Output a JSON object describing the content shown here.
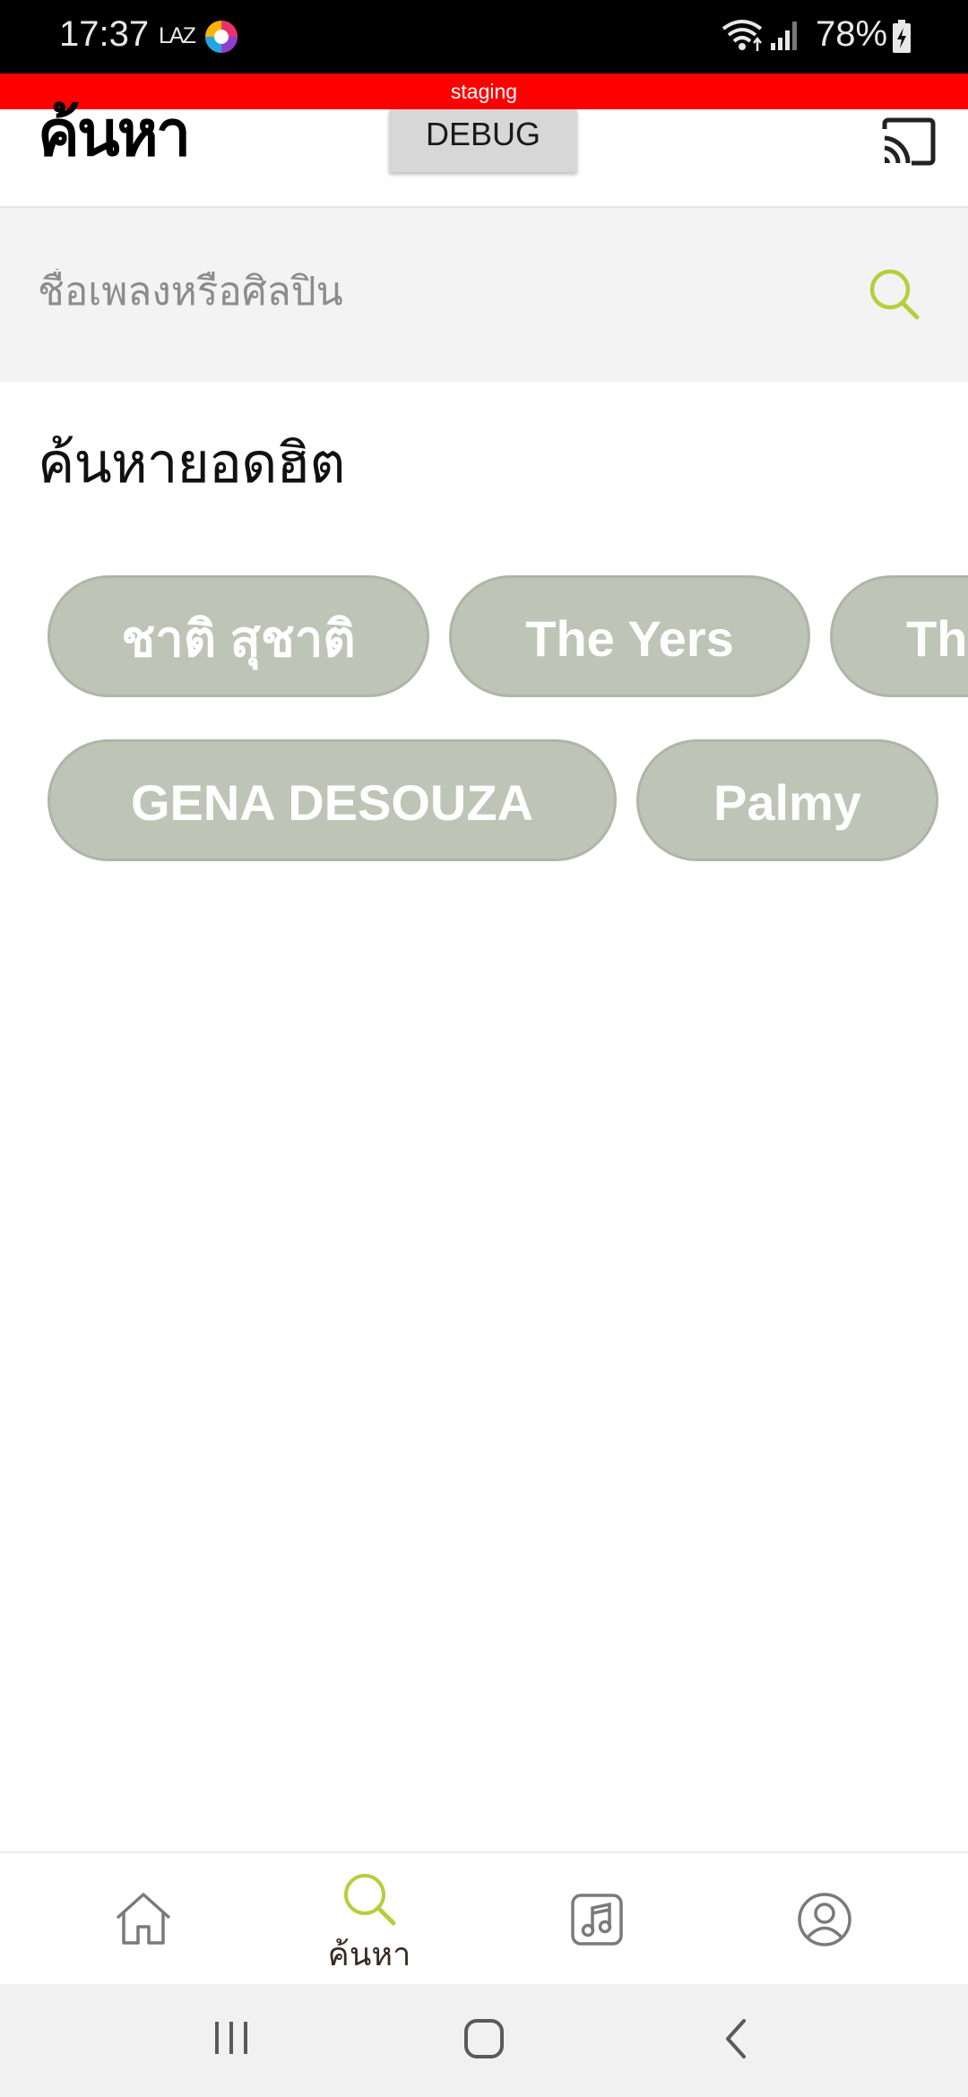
{
  "status_bar": {
    "time": "17:37",
    "notification_text": "LAZ",
    "battery_percent": "78%",
    "icons": [
      "app-icon",
      "wifi-icon",
      "signal-icon",
      "battery-charging-icon"
    ]
  },
  "banner": {
    "text": "staging",
    "color": "#ff0000"
  },
  "header": {
    "title": "ค้นหา",
    "debug_label": "DEBUG",
    "cast_icon": "cast-icon"
  },
  "search": {
    "placeholder": "ชื่อเพลงหรือศิลปิน",
    "value": "",
    "icon": "search-icon",
    "accent": "#b5cf3c"
  },
  "trending": {
    "title": "ค้นหายอดฮิต",
    "chips": [
      {
        "label": "ชาติ สุชาติ"
      },
      {
        "label": "The Yers"
      },
      {
        "label": "Th"
      },
      {
        "label": "GENA DESOUZA"
      },
      {
        "label": "Palmy"
      }
    ],
    "chip_color": "#bec4b6"
  },
  "bottom_nav": {
    "items": [
      {
        "icon": "home-icon",
        "label": ""
      },
      {
        "icon": "search-icon",
        "label": "ค้นหา",
        "active": true
      },
      {
        "icon": "music-icon",
        "label": ""
      },
      {
        "icon": "profile-icon",
        "label": ""
      }
    ],
    "active_color": "#b5cf3c"
  },
  "system_nav": {
    "icons": [
      "recent-apps-icon",
      "home-button-icon",
      "back-icon"
    ]
  }
}
